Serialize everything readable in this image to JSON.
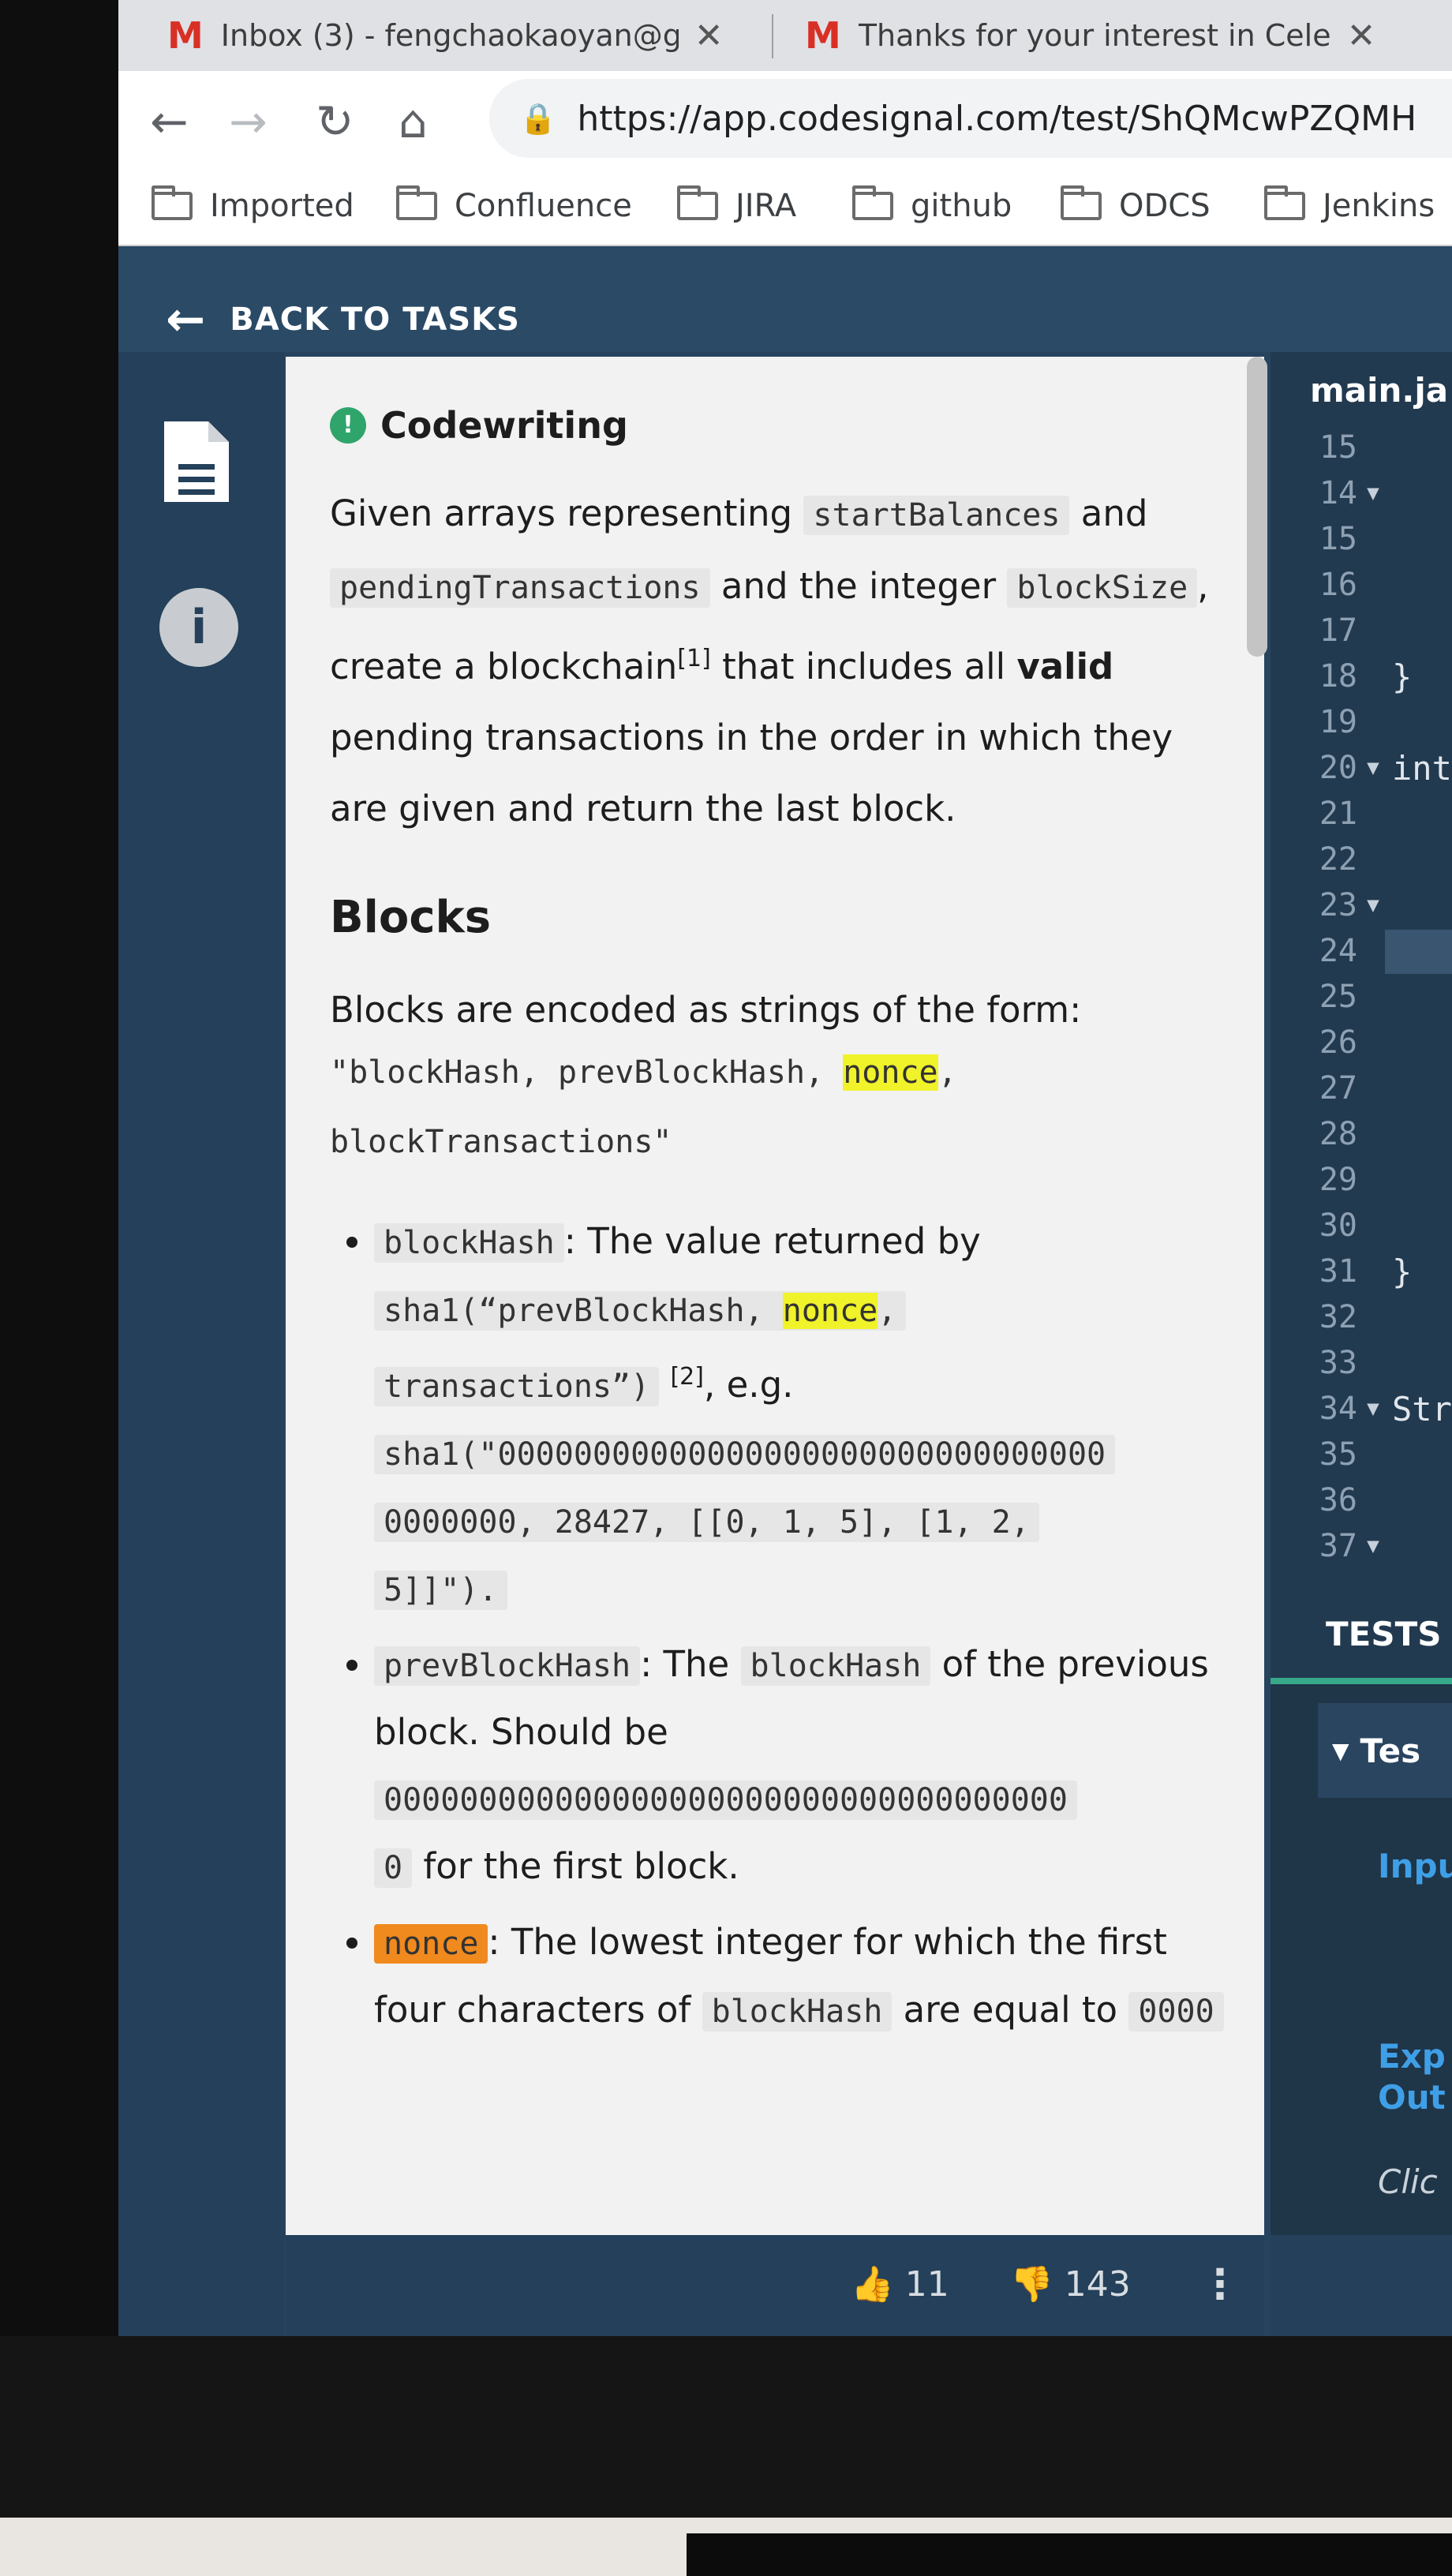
{
  "browser": {
    "tabs": [
      {
        "title": "Inbox (3) - fengchaokaoyan@g"
      },
      {
        "title": "Thanks for your interest in Cele"
      }
    ],
    "url": "https://app.codesignal.com/test/ShQMcwPZQMH",
    "bookmarks": [
      "Imported",
      "Confluence",
      "JIRA",
      "github",
      "ODCS",
      "Jenkins"
    ]
  },
  "app": {
    "back_label": "BACK TO TASKS"
  },
  "task": {
    "badge": "Codewriting",
    "intro": {
      "t1": "Given arrays representing ",
      "c1": "startBalances",
      "t2": " and ",
      "c2": "pendingTransactions",
      "t3": " and the integer ",
      "c3": "blockSize",
      "t4": ", create a blockchain",
      "ref1": "[1]",
      "t5": " that includes all ",
      "bold": "valid",
      "t6": " pending transactions in the order in which they are given and return the last block."
    },
    "blocks_heading": "Blocks",
    "blocks_intro": "Blocks are encoded as strings of the form:",
    "format_a": "\"blockHash, prevBlockHash, ",
    "format_nonce": "nonce",
    "format_b": ",",
    "format_c": "blockTransactions\"",
    "bullets": {
      "b1_code": "blockHash",
      "b1_t1": ": The value returned by",
      "b1_c2a": "sha1(“prevBlockHash, ",
      "b1_nonce": "nonce",
      "b1_c2b": ",",
      "b1_c3": "transactions”)",
      "b1_ref": "[2]",
      "b1_t2": ", e.g.",
      "b1_ex1": "sha1(\"00000000000000000000000000000000",
      "b1_ex2": "0000000, 28427, [[0, 1, 5], [1, 2,",
      "b1_ex3": "5]]\").",
      "b2_code": "prevBlockHash",
      "b2_t1": ": The ",
      "b2_code2": "blockHash",
      "b2_t2": " of the previous block. Should be",
      "b2_zeros": "000000000000000000000000000000000000",
      "b2_zero": "0",
      "b2_t3": " for the first block.",
      "b3_code": "nonce",
      "b3_t1": ": The lowest integer for which the first four characters of ",
      "b3_code2": "blockHash",
      "b3_t2": " are equal to ",
      "b3_code3": "0000"
    }
  },
  "footer": {
    "likes": "11",
    "dislikes": "143"
  },
  "editor": {
    "filename": "main.ja",
    "lines": [
      {
        "n": "15",
        "fold": false,
        "code": ""
      },
      {
        "n": "14",
        "fold": true,
        "code": ""
      },
      {
        "n": "15",
        "fold": false,
        "code": ""
      },
      {
        "n": "16",
        "fold": false,
        "code": ""
      },
      {
        "n": "17",
        "fold": false,
        "code": ""
      },
      {
        "n": "18",
        "fold": false,
        "code": "}"
      },
      {
        "n": "19",
        "fold": false,
        "code": ""
      },
      {
        "n": "20",
        "fold": true,
        "code": "int"
      },
      {
        "n": "21",
        "fold": false,
        "code": ""
      },
      {
        "n": "22",
        "fold": false,
        "code": ""
      },
      {
        "n": "23",
        "fold": true,
        "code": ""
      },
      {
        "n": "24",
        "fold": false,
        "code": ""
      },
      {
        "n": "25",
        "fold": false,
        "code": ""
      },
      {
        "n": "26",
        "fold": false,
        "code": ""
      },
      {
        "n": "27",
        "fold": false,
        "code": ""
      },
      {
        "n": "28",
        "fold": false,
        "code": ""
      },
      {
        "n": "29",
        "fold": false,
        "code": ""
      },
      {
        "n": "30",
        "fold": false,
        "code": ""
      },
      {
        "n": "31",
        "fold": false,
        "code": "}"
      },
      {
        "n": "32",
        "fold": false,
        "code": ""
      },
      {
        "n": "33",
        "fold": false,
        "code": ""
      },
      {
        "n": "34",
        "fold": true,
        "code": "Str"
      },
      {
        "n": "35",
        "fold": false,
        "code": ""
      },
      {
        "n": "36",
        "fold": false,
        "code": ""
      },
      {
        "n": "37",
        "fold": true,
        "code": ""
      }
    ]
  },
  "tests": {
    "heading": "TESTS",
    "row": "Tes",
    "input": "Inpu",
    "expected_1": "Exp",
    "expected_2": "Out",
    "click": "Clic"
  }
}
